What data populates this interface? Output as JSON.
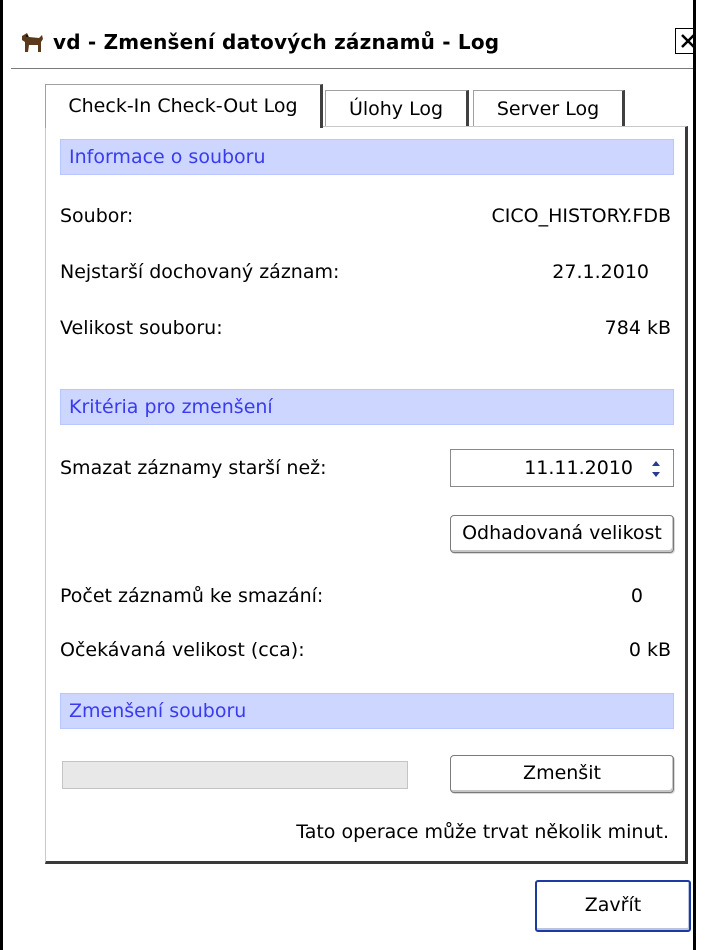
{
  "window": {
    "title": "vd - Zmenšení datových záznamů - Log",
    "icons": {
      "app": "dog-icon",
      "close": "close-icon"
    }
  },
  "tabs": [
    {
      "label": "Check-In Check-Out Log",
      "active": true
    },
    {
      "label": "Úlohy Log",
      "active": false
    },
    {
      "label": "Server Log",
      "active": false
    }
  ],
  "file_info": {
    "header": "Informace o souboru",
    "file_label": "Soubor:",
    "file_value": "CICO_HISTORY.FDB",
    "oldest_label": "Nejstarší dochovaný záznam:",
    "oldest_value": "27.1.2010",
    "size_label": "Velikost souboru:",
    "size_value": "784 kB"
  },
  "criteria": {
    "header": "Kritéria pro zmenšení",
    "delete_older_label": "Smazat záznamy starší než:",
    "delete_older_value": "11.11.2010",
    "estimate_button": "Odhadovaná velikost",
    "count_label": "Počet záznamů ke smazání:",
    "count_value": "0",
    "expected_label": "Očekávaná velikost (cca):",
    "expected_value": "0 kB"
  },
  "shrink": {
    "header": "Zmenšení souboru",
    "progress": 0,
    "button": "Zmenšit",
    "note": "Tato operace může trvat několik minut."
  },
  "footer": {
    "close_button": "Zavřít"
  },
  "colors": {
    "section_bg": "#ccd6ff",
    "section_text": "#3a3af0",
    "default_button_border": "#1c3aa0"
  }
}
